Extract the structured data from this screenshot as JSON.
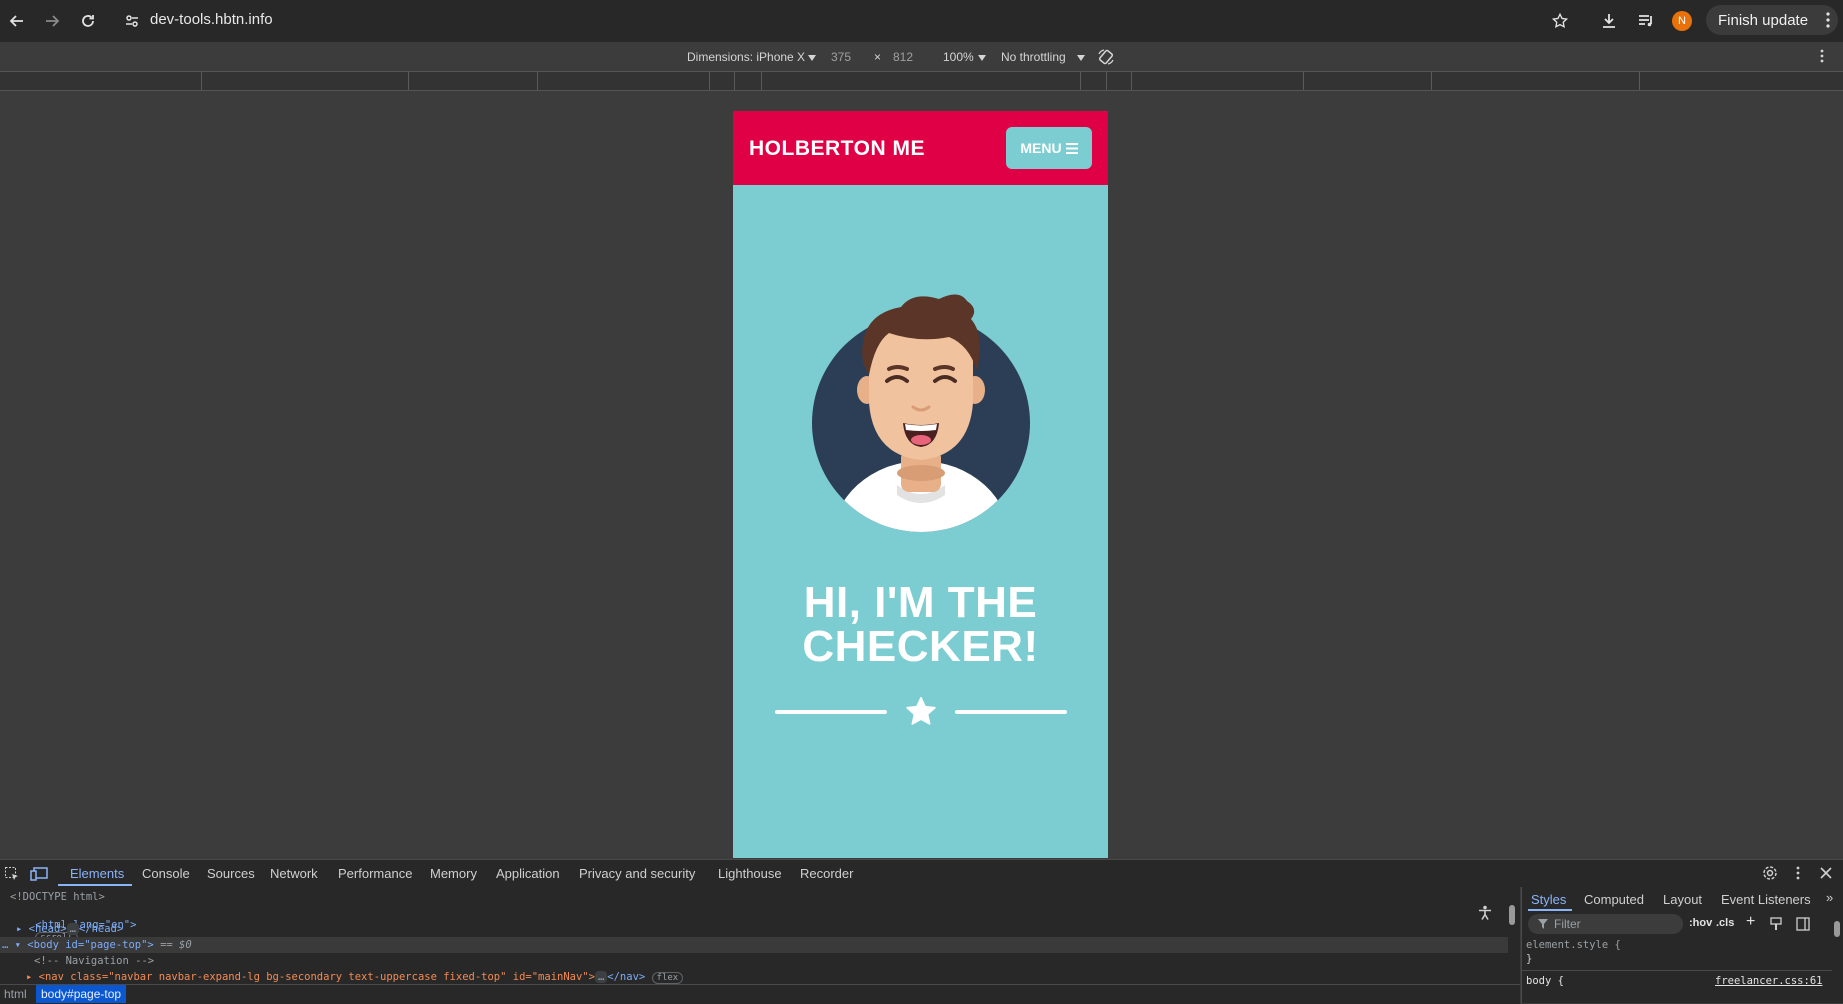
{
  "browser": {
    "url": "dev-tools.hbtn.info",
    "profile_initial": "N",
    "finish_update_label": "Finish update",
    "accent_color": "#e8710a"
  },
  "device_toolbar": {
    "dimensions_label": "Dimensions: iPhone X",
    "width": "375",
    "times": "×",
    "height": "812",
    "zoom": "100%",
    "throttling": "No throttling"
  },
  "page": {
    "brand": "HOLBERTON ME",
    "menu_label": "MENU",
    "hero_line1": "HI, I'M THE",
    "hero_line2": "CHECKER!",
    "colors": {
      "nav": "#e00045",
      "hero": "#7ccdd1"
    }
  },
  "devtools": {
    "tabs": [
      "Elements",
      "Console",
      "Sources",
      "Network",
      "Performance",
      "Memory",
      "Application",
      "Privacy and security",
      "Lighthouse",
      "Recorder"
    ],
    "dom": {
      "doctype": "<!DOCTYPE html>",
      "html_open": "<html lang=\"en\">",
      "scroll_badge": "scroll",
      "head": "<head>",
      "head_close": "</head>",
      "body": "<body id=\"page-top\">",
      "body_eq": "== $0",
      "comment": "<!-- Navigation -->",
      "nav": "<nav class=\"navbar navbar-expand-lg bg-secondary text-uppercase fixed-top\" id=\"mainNav\">",
      "nav_close": "</nav>",
      "flex_badge": "flex"
    },
    "breadcrumbs": [
      "html",
      "body#page-top"
    ],
    "styles_tabs": [
      "Styles",
      "Computed",
      "Layout",
      "Event Listeners"
    ],
    "filter_placeholder": "Filter",
    "hov": ":hov",
    "cls": ".cls",
    "element_style": "element.style {",
    "close_brace": "}",
    "body_rule": "body {",
    "source_link": "freelancer.css:61"
  }
}
